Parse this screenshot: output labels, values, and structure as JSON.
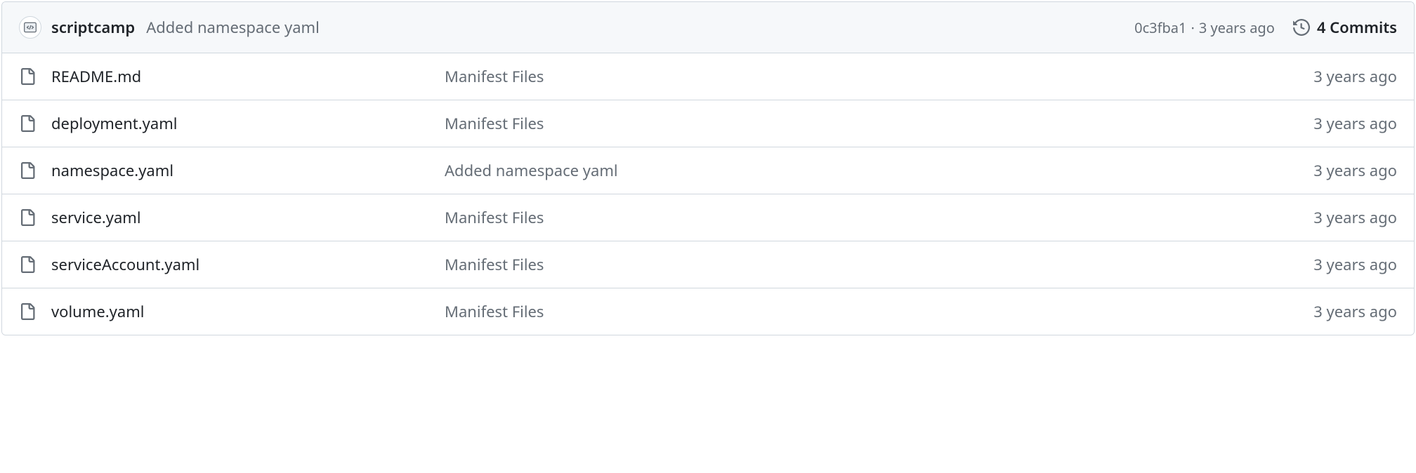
{
  "header": {
    "author": "scriptcamp",
    "commit_message": "Added namespace yaml",
    "commit_hash": "0c3fba1",
    "commit_ago": "3 years ago",
    "commits_label": "4 Commits"
  },
  "files": [
    {
      "name": "README.md",
      "commit": "Manifest Files",
      "ago": "3 years ago"
    },
    {
      "name": "deployment.yaml",
      "commit": "Manifest Files",
      "ago": "3 years ago"
    },
    {
      "name": "namespace.yaml",
      "commit": "Added namespace yaml",
      "ago": "3 years ago"
    },
    {
      "name": "service.yaml",
      "commit": "Manifest Files",
      "ago": "3 years ago"
    },
    {
      "name": "serviceAccount.yaml",
      "commit": "Manifest Files",
      "ago": "3 years ago"
    },
    {
      "name": "volume.yaml",
      "commit": "Manifest Files",
      "ago": "3 years ago"
    }
  ]
}
